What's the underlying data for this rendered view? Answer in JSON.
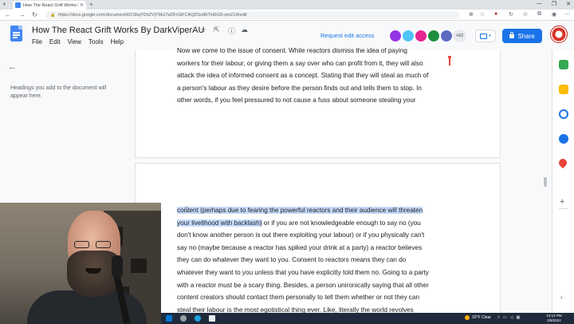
{
  "browser": {
    "tab_title": "How The React Grift Works By DarkViperAU - Go...",
    "tab_close": "✕",
    "new_tab": "+",
    "url": "https://docs.google.com/document/d/1SbqYDhZVjY9bJ7aDFrGiFCAQDSu8KTH6GD-qmZ1A/edit",
    "window_controls": [
      "—",
      "❐",
      "✕"
    ]
  },
  "docs": {
    "title": "How The React Grift Works By DarkViperAU",
    "menus": [
      "File",
      "Edit",
      "View",
      "Tools",
      "Help"
    ],
    "request_edit_access": "Request edit access",
    "collaborator_count": "+62",
    "share_label": "Share",
    "collaborator_colors": [
      "#9334e6",
      "#4fc3f7",
      "#e52592",
      "#1e8e3e",
      "#5c6bc0"
    ]
  },
  "outline": {
    "hint": "Headings you add to the document will appear here."
  },
  "page1": {
    "lines": [
      "Now we come to the issue of consent. While reactors dismiss the idea of paying",
      "workers for their labour, or giving them a say over who can profit from it, they will also",
      "attack the idea of informed consent as a concept. Stating that they will steal as much of",
      "a person's labour as they desire before the person finds out and tells them to stop. In",
      "other words, if you feel pressured to not cause a fuss about someone stealing your"
    ]
  },
  "page2": {
    "highlight_line1": "content (perhaps due to fearing the powerful reactors and their audience will threaten",
    "highlight_line2": "your livelihood with backlash)",
    "line2_rest": " or if you are not knowledgeable enough to say no (you",
    "lines": [
      "don't know another person is out there exploiting your labour) or if you physically can't",
      "say no (maybe because a reactor has spiked your drink at a party) a reactor believes",
      "they can do whatever they want to you. Consent to reactors means they can do",
      "whatever they want to you unless that you have explicitly told them no. Going to a party",
      "with a reactor must be a scary thing. Besides, a person unironically saying that all other",
      "content creators should contact them personally to tell them whether or not they can",
      "steal their labour is the most egotistical thing ever. Like, literally the world revolves"
    ]
  },
  "taskbar": {
    "weather": "32°F  Clear",
    "time": "10:12 PM",
    "date": "2/8/2022"
  }
}
